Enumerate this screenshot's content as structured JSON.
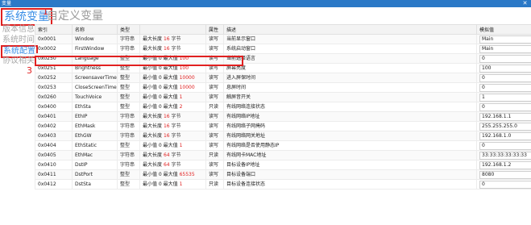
{
  "window": {
    "title": "变量",
    "close_glyph": "✕"
  },
  "tabs": {
    "system": "系统变量",
    "custom": "自定义变量"
  },
  "markers": {
    "one": "1",
    "three": "3"
  },
  "sidebar": {
    "items": [
      {
        "label": "版本信息"
      },
      {
        "label": "系统时间"
      },
      {
        "label": "系统配置",
        "active": true
      },
      {
        "label": "协议相关"
      }
    ]
  },
  "table": {
    "headers": [
      "索引",
      "名称",
      "类型",
      "",
      "属性",
      "描述",
      "模拟值"
    ],
    "rows": [
      {
        "index": "0x0001",
        "name": "Window",
        "type": "字符串",
        "len_pre": "最大长度",
        "len_val": "16",
        "len_unit": "字节",
        "attr": "读写",
        "desc": "当前显示窗口",
        "sim": "Main"
      },
      {
        "index": "0x0002",
        "name": "FirstWindow",
        "type": "字符串",
        "len_pre": "最大长度",
        "len_val": "16",
        "len_unit": "字节",
        "attr": "读写",
        "desc": "系统启动窗口",
        "sim": "Main"
      },
      {
        "index": "0x0250",
        "name": "Language",
        "type": "整型",
        "len_pre": "最小值 0 最大值",
        "len_val": "100",
        "len_unit": "",
        "attr": "读写",
        "desc": "当前选择语言",
        "sim": "0"
      },
      {
        "index": "0x0251",
        "name": "Brightness",
        "type": "整型",
        "len_pre": "最小值 0 最大值",
        "len_val": "100",
        "len_unit": "",
        "attr": "读写",
        "desc": "屏幕亮度",
        "sim": "100"
      },
      {
        "index": "0x0252",
        "name": "ScreensaverTime",
        "type": "整型",
        "len_pre": "最小值 0 最大值",
        "len_val": "10000",
        "len_unit": "",
        "attr": "读写",
        "desc": "进入屏保时间",
        "sim": "0"
      },
      {
        "index": "0x0253",
        "name": "CloseScreenTime",
        "type": "整型",
        "len_pre": "最小值 0 最大值",
        "len_val": "10000",
        "len_unit": "",
        "attr": "读写",
        "desc": "息屏时间",
        "sim": "0"
      },
      {
        "index": "0x0260",
        "name": "TouchVoice",
        "type": "整型",
        "len_pre": "最小值 0 最大值",
        "len_val": "1",
        "len_unit": "",
        "attr": "读写",
        "desc": "触屏音开关",
        "sim": "1"
      },
      {
        "index": "0x0400",
        "name": "EthSta",
        "type": "整型",
        "len_pre": "最小值 0 最大值",
        "len_val": "2",
        "len_unit": "",
        "attr": "只读",
        "desc": "有线网络连接状态",
        "sim": "0"
      },
      {
        "index": "0x0401",
        "name": "EthIP",
        "type": "字符串",
        "len_pre": "最大长度",
        "len_val": "16",
        "len_unit": "字节",
        "attr": "读写",
        "desc": "有线网络IP地址",
        "sim": "192.168.1.1"
      },
      {
        "index": "0x0402",
        "name": "EthMask",
        "type": "字符串",
        "len_pre": "最大长度",
        "len_val": "16",
        "len_unit": "字节",
        "attr": "读写",
        "desc": "有线网络子网掩码",
        "sim": "255.255.255.0"
      },
      {
        "index": "0x0403",
        "name": "EthGW",
        "type": "字符串",
        "len_pre": "最大长度",
        "len_val": "16",
        "len_unit": "字节",
        "attr": "读写",
        "desc": "有线网络网关地址",
        "sim": "192.168.1.0"
      },
      {
        "index": "0x0404",
        "name": "EthStatic",
        "type": "整型",
        "len_pre": "最小值 0 最大值",
        "len_val": "1",
        "len_unit": "",
        "attr": "读写",
        "desc": "有线网络是否使用静态IP",
        "sim": "0"
      },
      {
        "index": "0x0405",
        "name": "EthMac",
        "type": "字符串",
        "len_pre": "最大长度",
        "len_val": "64",
        "len_unit": "字节",
        "attr": "只读",
        "desc": "有线网卡MAC地址",
        "sim": "33:33:33:33:33:33"
      },
      {
        "index": "0x0410",
        "name": "DstIP",
        "type": "字符串",
        "len_pre": "最大长度",
        "len_val": "64",
        "len_unit": "字节",
        "attr": "读写",
        "desc": "目标设备IP地址",
        "sim": "192.168.1.2"
      },
      {
        "index": "0x0411",
        "name": "DstPort",
        "type": "整型",
        "len_pre": "最小值 0 最大值",
        "len_val": "65535",
        "len_unit": "",
        "attr": "读写",
        "desc": "目标设备端口",
        "sim": "8080"
      },
      {
        "index": "0x0412",
        "name": "DstSta",
        "type": "整型",
        "len_pre": "最小值 0 最大值",
        "len_val": "1",
        "len_unit": "",
        "attr": "只读",
        "desc": "目标设备连接状态",
        "sim": "0"
      }
    ]
  },
  "colors": {
    "titlebar": "#2b79c7",
    "accent": "#3a8ee6",
    "highlight": "#e02020"
  }
}
